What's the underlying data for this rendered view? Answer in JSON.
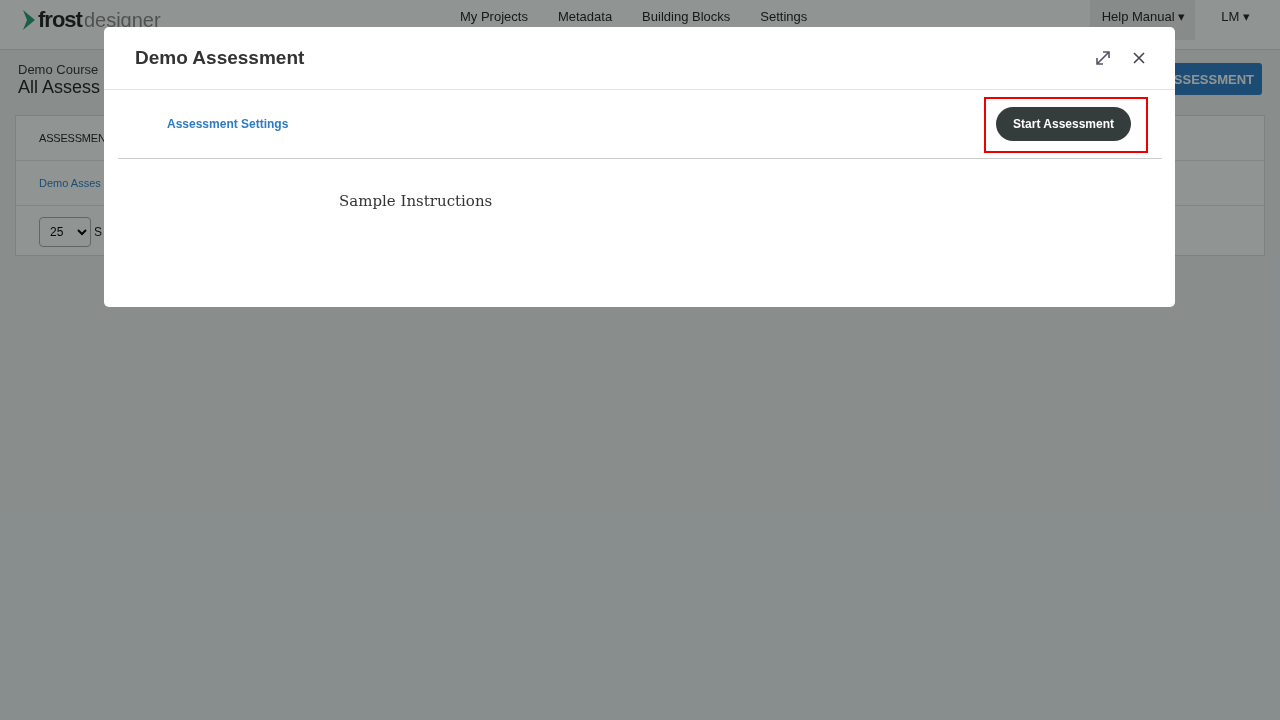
{
  "header": {
    "logo": {
      "word_1": "frost",
      "word_2": "designer"
    },
    "nav": [
      {
        "label": "My Projects"
      },
      {
        "label": "Metadata"
      },
      {
        "label": "Building Blocks"
      },
      {
        "label": "Settings"
      }
    ],
    "help_menu": {
      "label": "Help Manual",
      "caret": "▾"
    },
    "user_menu": {
      "label": "LM",
      "caret": "▾"
    }
  },
  "subheader": {
    "course": "Demo Course",
    "title": "All Assess",
    "action_button": "SSESSMENT"
  },
  "table": {
    "column_1": "ASSESSMEN",
    "rows": [
      {
        "name": "Demo Asses"
      }
    ],
    "page_size": "25",
    "footer_text": "S"
  },
  "modal": {
    "title": "Demo Assessment",
    "settings_link": "Assessment Settings",
    "start_button": {
      "label": "Start Assessment",
      "highlighted": true
    },
    "instructions": "Sample Instructions"
  }
}
